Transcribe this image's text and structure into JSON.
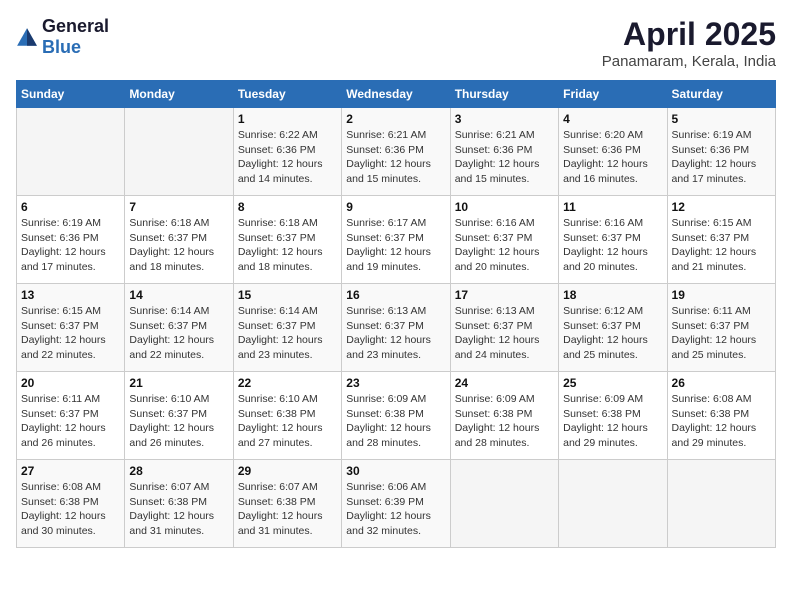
{
  "header": {
    "logo_general": "General",
    "logo_blue": "Blue",
    "month_title": "April 2025",
    "location": "Panamaram, Kerala, India"
  },
  "days_of_week": [
    "Sunday",
    "Monday",
    "Tuesday",
    "Wednesday",
    "Thursday",
    "Friday",
    "Saturday"
  ],
  "weeks": [
    [
      {
        "day": "",
        "sunrise": "",
        "sunset": "",
        "daylight": ""
      },
      {
        "day": "",
        "sunrise": "",
        "sunset": "",
        "daylight": ""
      },
      {
        "day": "1",
        "sunrise": "Sunrise: 6:22 AM",
        "sunset": "Sunset: 6:36 PM",
        "daylight": "Daylight: 12 hours and 14 minutes."
      },
      {
        "day": "2",
        "sunrise": "Sunrise: 6:21 AM",
        "sunset": "Sunset: 6:36 PM",
        "daylight": "Daylight: 12 hours and 15 minutes."
      },
      {
        "day": "3",
        "sunrise": "Sunrise: 6:21 AM",
        "sunset": "Sunset: 6:36 PM",
        "daylight": "Daylight: 12 hours and 15 minutes."
      },
      {
        "day": "4",
        "sunrise": "Sunrise: 6:20 AM",
        "sunset": "Sunset: 6:36 PM",
        "daylight": "Daylight: 12 hours and 16 minutes."
      },
      {
        "day": "5",
        "sunrise": "Sunrise: 6:19 AM",
        "sunset": "Sunset: 6:36 PM",
        "daylight": "Daylight: 12 hours and 17 minutes."
      }
    ],
    [
      {
        "day": "6",
        "sunrise": "Sunrise: 6:19 AM",
        "sunset": "Sunset: 6:36 PM",
        "daylight": "Daylight: 12 hours and 17 minutes."
      },
      {
        "day": "7",
        "sunrise": "Sunrise: 6:18 AM",
        "sunset": "Sunset: 6:37 PM",
        "daylight": "Daylight: 12 hours and 18 minutes."
      },
      {
        "day": "8",
        "sunrise": "Sunrise: 6:18 AM",
        "sunset": "Sunset: 6:37 PM",
        "daylight": "Daylight: 12 hours and 18 minutes."
      },
      {
        "day": "9",
        "sunrise": "Sunrise: 6:17 AM",
        "sunset": "Sunset: 6:37 PM",
        "daylight": "Daylight: 12 hours and 19 minutes."
      },
      {
        "day": "10",
        "sunrise": "Sunrise: 6:16 AM",
        "sunset": "Sunset: 6:37 PM",
        "daylight": "Daylight: 12 hours and 20 minutes."
      },
      {
        "day": "11",
        "sunrise": "Sunrise: 6:16 AM",
        "sunset": "Sunset: 6:37 PM",
        "daylight": "Daylight: 12 hours and 20 minutes."
      },
      {
        "day": "12",
        "sunrise": "Sunrise: 6:15 AM",
        "sunset": "Sunset: 6:37 PM",
        "daylight": "Daylight: 12 hours and 21 minutes."
      }
    ],
    [
      {
        "day": "13",
        "sunrise": "Sunrise: 6:15 AM",
        "sunset": "Sunset: 6:37 PM",
        "daylight": "Daylight: 12 hours and 22 minutes."
      },
      {
        "day": "14",
        "sunrise": "Sunrise: 6:14 AM",
        "sunset": "Sunset: 6:37 PM",
        "daylight": "Daylight: 12 hours and 22 minutes."
      },
      {
        "day": "15",
        "sunrise": "Sunrise: 6:14 AM",
        "sunset": "Sunset: 6:37 PM",
        "daylight": "Daylight: 12 hours and 23 minutes."
      },
      {
        "day": "16",
        "sunrise": "Sunrise: 6:13 AM",
        "sunset": "Sunset: 6:37 PM",
        "daylight": "Daylight: 12 hours and 23 minutes."
      },
      {
        "day": "17",
        "sunrise": "Sunrise: 6:13 AM",
        "sunset": "Sunset: 6:37 PM",
        "daylight": "Daylight: 12 hours and 24 minutes."
      },
      {
        "day": "18",
        "sunrise": "Sunrise: 6:12 AM",
        "sunset": "Sunset: 6:37 PM",
        "daylight": "Daylight: 12 hours and 25 minutes."
      },
      {
        "day": "19",
        "sunrise": "Sunrise: 6:11 AM",
        "sunset": "Sunset: 6:37 PM",
        "daylight": "Daylight: 12 hours and 25 minutes."
      }
    ],
    [
      {
        "day": "20",
        "sunrise": "Sunrise: 6:11 AM",
        "sunset": "Sunset: 6:37 PM",
        "daylight": "Daylight: 12 hours and 26 minutes."
      },
      {
        "day": "21",
        "sunrise": "Sunrise: 6:10 AM",
        "sunset": "Sunset: 6:37 PM",
        "daylight": "Daylight: 12 hours and 26 minutes."
      },
      {
        "day": "22",
        "sunrise": "Sunrise: 6:10 AM",
        "sunset": "Sunset: 6:38 PM",
        "daylight": "Daylight: 12 hours and 27 minutes."
      },
      {
        "day": "23",
        "sunrise": "Sunrise: 6:09 AM",
        "sunset": "Sunset: 6:38 PM",
        "daylight": "Daylight: 12 hours and 28 minutes."
      },
      {
        "day": "24",
        "sunrise": "Sunrise: 6:09 AM",
        "sunset": "Sunset: 6:38 PM",
        "daylight": "Daylight: 12 hours and 28 minutes."
      },
      {
        "day": "25",
        "sunrise": "Sunrise: 6:09 AM",
        "sunset": "Sunset: 6:38 PM",
        "daylight": "Daylight: 12 hours and 29 minutes."
      },
      {
        "day": "26",
        "sunrise": "Sunrise: 6:08 AM",
        "sunset": "Sunset: 6:38 PM",
        "daylight": "Daylight: 12 hours and 29 minutes."
      }
    ],
    [
      {
        "day": "27",
        "sunrise": "Sunrise: 6:08 AM",
        "sunset": "Sunset: 6:38 PM",
        "daylight": "Daylight: 12 hours and 30 minutes."
      },
      {
        "day": "28",
        "sunrise": "Sunrise: 6:07 AM",
        "sunset": "Sunset: 6:38 PM",
        "daylight": "Daylight: 12 hours and 31 minutes."
      },
      {
        "day": "29",
        "sunrise": "Sunrise: 6:07 AM",
        "sunset": "Sunset: 6:38 PM",
        "daylight": "Daylight: 12 hours and 31 minutes."
      },
      {
        "day": "30",
        "sunrise": "Sunrise: 6:06 AM",
        "sunset": "Sunset: 6:39 PM",
        "daylight": "Daylight: 12 hours and 32 minutes."
      },
      {
        "day": "",
        "sunrise": "",
        "sunset": "",
        "daylight": ""
      },
      {
        "day": "",
        "sunrise": "",
        "sunset": "",
        "daylight": ""
      },
      {
        "day": "",
        "sunrise": "",
        "sunset": "",
        "daylight": ""
      }
    ]
  ]
}
